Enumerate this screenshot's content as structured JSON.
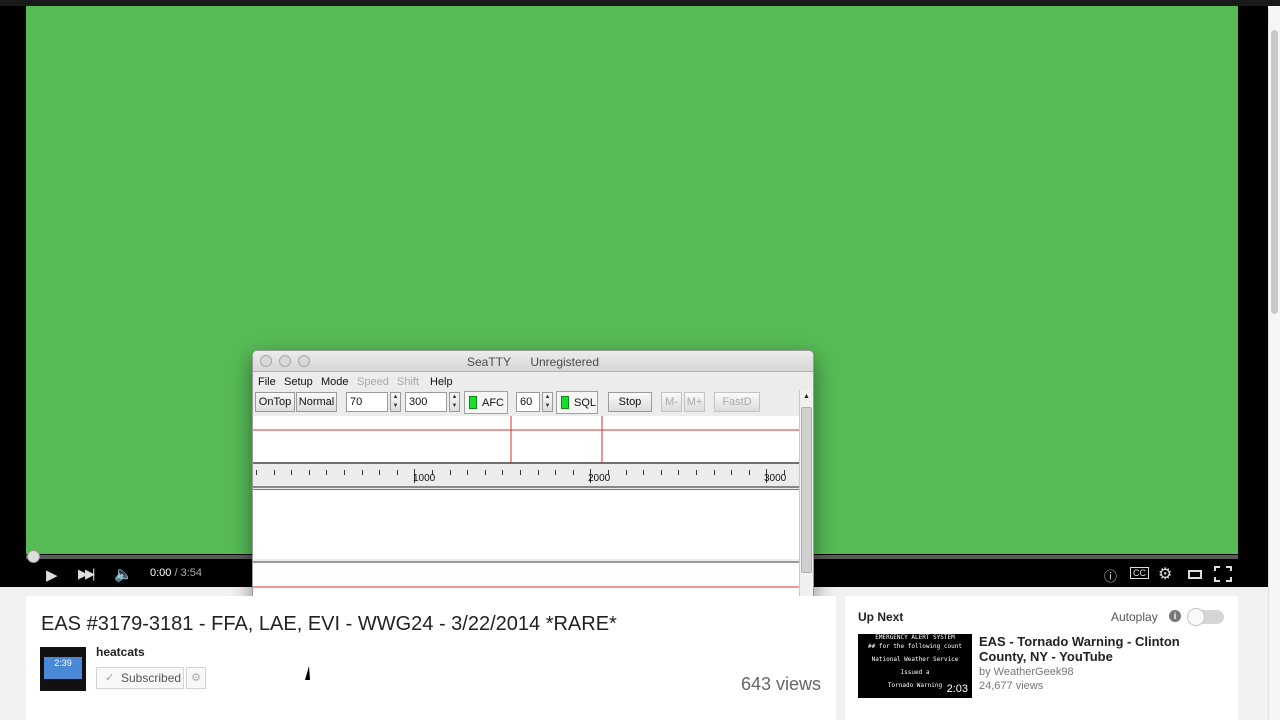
{
  "player": {
    "time_current": "0:00",
    "time_total": "/ 3:54",
    "progress": 0
  },
  "seatty": {
    "title": "SeaTTY",
    "status": "Unregistered",
    "menu": [
      {
        "label": "File",
        "disabled": false
      },
      {
        "label": "Setup",
        "disabled": false
      },
      {
        "label": "Mode",
        "disabled": false
      },
      {
        "label": "Speed",
        "disabled": true
      },
      {
        "label": "Shift",
        "disabled": true
      },
      {
        "label": "Help",
        "disabled": false
      }
    ],
    "toolbar": {
      "ontop": "OnTop",
      "normal": "Normal",
      "freq_value": "70",
      "shift_value": "300",
      "afc_label": "AFC",
      "sql_value": "60",
      "sql_label": "SQL",
      "stop": "Stop",
      "m_minus": "M-",
      "m_plus": "M+",
      "fastd": "FastD"
    },
    "ruler_labels": [
      "1000",
      "2000",
      "3000"
    ],
    "colors": {
      "led": "#18e02a",
      "marker": "#d43030"
    }
  },
  "video": {
    "title": "EAS #3179-3181 - FFA, LAE, EVI - WWG24 - 3/22/2014 *RARE*",
    "channel": "heatcats",
    "channel_thumb_text": "2:39",
    "subscribe_label": "Subscribed",
    "views": "643 views"
  },
  "sidebar": {
    "up_next_label": "Up Next",
    "autoplay_label": "Autoplay",
    "next_video": {
      "thumb_lines": [
        "EMERGENCY ALERT SYSTEM",
        "## for the following count",
        "National Weather Service",
        "Issued a",
        "Tornado Warning"
      ],
      "duration": "2:03",
      "title": "EAS - Tornado Warning - Clinton County, NY - YouTube",
      "by": "by WeatherGeek98",
      "views": "24,677 views"
    }
  }
}
